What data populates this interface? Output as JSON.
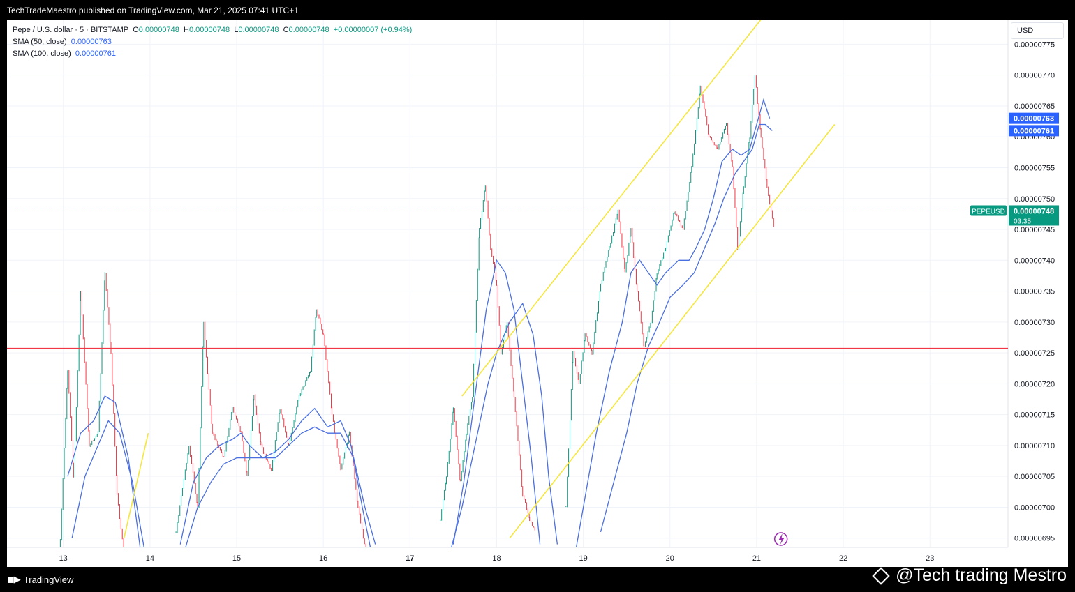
{
  "header": {
    "published_text": "TechTradeMaestro published on TradingView.com, Mar 21, 2025 07:41 UTC+1"
  },
  "legend": {
    "symbol": "Pepe / U.S. dollar · 5 · BITSTAMP",
    "o_label": "O",
    "o_value": "0.00000748",
    "h_label": "H",
    "h_value": "0.00000748",
    "l_label": "L",
    "l_value": "0.00000748",
    "c_label": "C",
    "c_value": "0.00000748",
    "change": "+0.00000007 (+0.94%)",
    "sma50_label": "SMA (50, close)",
    "sma50_value": "0.00000763",
    "sma100_label": "SMA (100, close)",
    "sma100_value": "0.00000761"
  },
  "currency": "USD",
  "footer": {
    "brand": "TradingView",
    "watermark": "@Tech trading Mestro"
  },
  "colors": {
    "up": "#089981",
    "down": "#f23645",
    "sma": "#4a6fe0",
    "support": "#f23645",
    "channel": "#f5e63c",
    "last": "#089981",
    "sma_label": "#2962ff"
  },
  "chart_data": {
    "type": "candlestick",
    "symbol": "PEPEUSD",
    "x_ticks": [
      {
        "label": "13",
        "x": 13.0
      },
      {
        "label": "14",
        "x": 14.0
      },
      {
        "label": "15",
        "x": 15.0
      },
      {
        "label": "16",
        "x": 16.0
      },
      {
        "label": "17",
        "x": 17.0
      },
      {
        "label": "18",
        "x": 18.0
      },
      {
        "label": "19",
        "x": 19.0
      },
      {
        "label": "20",
        "x": 20.0
      },
      {
        "label": "21",
        "x": 21.0
      },
      {
        "label": "22",
        "x": 22.0
      },
      {
        "label": "23",
        "x": 23.0
      }
    ],
    "xlim": [
      12.35,
      23.9
    ],
    "ylim": [
      6.935e-06,
      7.79e-06
    ],
    "y_ticks": [
      "0.00000695",
      "0.00000700",
      "0.00000705",
      "0.00000710",
      "0.00000715",
      "0.00000720",
      "0.00000725",
      "0.00000730",
      "0.00000735",
      "0.00000740",
      "0.00000745",
      "0.00000750",
      "0.00000755",
      "0.00000760",
      "0.00000765",
      "0.00000770",
      "0.00000775"
    ],
    "last_price": {
      "label": "PEPEUSD",
      "value": 7.48e-06,
      "value_text": "0.00000748",
      "countdown": "03:35"
    },
    "sma_labels": [
      {
        "text": "0.00000763",
        "value": 7.63e-06
      },
      {
        "text": "0.00000761",
        "value": 7.61e-06
      }
    ],
    "support_level": 7.257e-06,
    "channel_lines": [
      {
        "x": [
          17.6,
          21.05
        ],
        "y": [
          7.18e-06,
          7.79e-06
        ]
      },
      {
        "x": [
          18.15,
          21.9
        ],
        "y": [
          6.95e-06,
          7.62e-06
        ]
      },
      {
        "x": [
          13.7,
          13.98
        ],
        "y": [
          6.95e-06,
          7.12e-06
        ]
      }
    ],
    "price_path": [
      [
        12.95,
        6.9e-06
      ],
      [
        13.05,
        7.22e-06
      ],
      [
        13.12,
        7.05e-06
      ],
      [
        13.2,
        7.35e-06
      ],
      [
        13.3,
        7.1e-06
      ],
      [
        13.4,
        7.12e-06
      ],
      [
        13.48,
        7.38e-06
      ],
      [
        13.55,
        7.25e-06
      ],
      [
        13.62,
        7.02e-06
      ],
      [
        13.72,
        6.9e-06
      ],
      [
        14.3,
        6.96e-06
      ],
      [
        14.45,
        7.1e-06
      ],
      [
        14.55,
        7e-06
      ],
      [
        14.62,
        7.3e-06
      ],
      [
        14.72,
        7.12e-06
      ],
      [
        14.85,
        7.08e-06
      ],
      [
        14.95,
        7.16e-06
      ],
      [
        15.05,
        7.12e-06
      ],
      [
        15.12,
        7.05e-06
      ],
      [
        15.2,
        7.18e-06
      ],
      [
        15.28,
        7.1e-06
      ],
      [
        15.4,
        7.06e-06
      ],
      [
        15.5,
        7.16e-06
      ],
      [
        15.6,
        7.1e-06
      ],
      [
        15.72,
        7.18e-06
      ],
      [
        15.85,
        7.22e-06
      ],
      [
        15.92,
        7.32e-06
      ],
      [
        16.0,
        7.28e-06
      ],
      [
        16.1,
        7.15e-06
      ],
      [
        16.2,
        7.06e-06
      ],
      [
        16.3,
        7.12e-06
      ],
      [
        16.4,
        7e-06
      ],
      [
        16.5,
        6.92e-06
      ],
      [
        17.35,
        6.98e-06
      ],
      [
        17.42,
        7.05e-06
      ],
      [
        17.5,
        7.16e-06
      ],
      [
        17.58,
        7.04e-06
      ],
      [
        17.65,
        7.12e-06
      ],
      [
        17.72,
        7.18e-06
      ],
      [
        17.8,
        7.45e-06
      ],
      [
        17.87,
        7.52e-06
      ],
      [
        17.93,
        7.42e-06
      ],
      [
        18.0,
        7.36e-06
      ],
      [
        18.05,
        7.25e-06
      ],
      [
        18.12,
        7.3e-06
      ],
      [
        18.2,
        7.18e-06
      ],
      [
        18.3,
        7.02e-06
      ],
      [
        18.38,
        6.98e-06
      ],
      [
        18.45,
        6.96e-06
      ],
      [
        18.8,
        7e-06
      ],
      [
        18.88,
        7.25e-06
      ],
      [
        18.95,
        7.2e-06
      ],
      [
        19.02,
        7.28e-06
      ],
      [
        19.1,
        7.25e-06
      ],
      [
        19.2,
        7.36e-06
      ],
      [
        19.3,
        7.42e-06
      ],
      [
        19.4,
        7.48e-06
      ],
      [
        19.48,
        7.38e-06
      ],
      [
        19.55,
        7.45e-06
      ],
      [
        19.62,
        7.35e-06
      ],
      [
        19.7,
        7.26e-06
      ],
      [
        19.78,
        7.3e-06
      ],
      [
        19.85,
        7.38e-06
      ],
      [
        19.95,
        7.42e-06
      ],
      [
        20.05,
        7.48e-06
      ],
      [
        20.15,
        7.45e-06
      ],
      [
        20.25,
        7.55e-06
      ],
      [
        20.35,
        7.68e-06
      ],
      [
        20.45,
        7.6e-06
      ],
      [
        20.55,
        7.58e-06
      ],
      [
        20.65,
        7.62e-06
      ],
      [
        20.72,
        7.55e-06
      ],
      [
        20.78,
        7.42e-06
      ],
      [
        20.85,
        7.52e-06
      ],
      [
        20.92,
        7.6e-06
      ],
      [
        20.98,
        7.7e-06
      ],
      [
        21.05,
        7.6e-06
      ],
      [
        21.12,
        7.52e-06
      ],
      [
        21.2,
        7.45e-06
      ]
    ],
    "sma_50": [
      [
        13.05,
        7.05e-06
      ],
      [
        13.2,
        7.12e-06
      ],
      [
        13.35,
        7.14e-06
      ],
      [
        13.48,
        7.18e-06
      ],
      [
        13.6,
        7.17e-06
      ],
      [
        13.75,
        7.08e-06
      ],
      [
        13.9,
        6.92e-06
      ],
      [
        14.35,
        6.94e-06
      ],
      [
        14.5,
        7.04e-06
      ],
      [
        14.65,
        7.08e-06
      ],
      [
        14.8,
        7.1e-06
      ],
      [
        14.95,
        7.11e-06
      ],
      [
        15.05,
        7.12e-06
      ],
      [
        15.15,
        7.1e-06
      ],
      [
        15.3,
        7.08e-06
      ],
      [
        15.45,
        7.09e-06
      ],
      [
        15.6,
        7.11e-06
      ],
      [
        15.75,
        7.14e-06
      ],
      [
        15.9,
        7.16e-06
      ],
      [
        16.05,
        7.13e-06
      ],
      [
        16.2,
        7.14e-06
      ],
      [
        16.32,
        7.1e-06
      ],
      [
        16.45,
        7e-06
      ],
      [
        16.55,
        6.93e-06
      ],
      [
        17.5,
        6.94e-06
      ],
      [
        17.62,
        7.04e-06
      ],
      [
        17.75,
        7.18e-06
      ],
      [
        17.88,
        7.32e-06
      ],
      [
        18.0,
        7.4e-06
      ],
      [
        18.1,
        7.38e-06
      ],
      [
        18.2,
        7.32e-06
      ],
      [
        18.3,
        7.2e-06
      ],
      [
        18.4,
        7.08e-06
      ],
      [
        18.5,
        6.94e-06
      ],
      [
        18.9,
        6.92e-06
      ],
      [
        19.0,
        7e-06
      ],
      [
        19.15,
        7.12e-06
      ],
      [
        19.3,
        7.22e-06
      ],
      [
        19.45,
        7.3e-06
      ],
      [
        19.55,
        7.38e-06
      ],
      [
        19.65,
        7.4e-06
      ],
      [
        19.75,
        7.38e-06
      ],
      [
        19.85,
        7.36e-06
      ],
      [
        19.95,
        7.38e-06
      ],
      [
        20.1,
        7.4e-06
      ],
      [
        20.22,
        7.4e-06
      ],
      [
        20.3,
        7.42e-06
      ],
      [
        20.4,
        7.45e-06
      ],
      [
        20.5,
        7.5e-06
      ],
      [
        20.6,
        7.56e-06
      ],
      [
        20.72,
        7.58e-06
      ],
      [
        20.82,
        7.57e-06
      ],
      [
        20.92,
        7.58e-06
      ],
      [
        21.0,
        7.62e-06
      ],
      [
        21.08,
        7.66e-06
      ],
      [
        21.15,
        7.63e-06
      ]
    ],
    "sma_100": [
      [
        13.1,
        6.95e-06
      ],
      [
        13.25,
        7.05e-06
      ],
      [
        13.4,
        7.1e-06
      ],
      [
        13.52,
        7.14e-06
      ],
      [
        13.65,
        7.12e-06
      ],
      [
        13.8,
        7.04e-06
      ],
      [
        13.95,
        6.92e-06
      ],
      [
        14.4,
        6.93e-06
      ],
      [
        14.55,
        7e-06
      ],
      [
        14.7,
        7.04e-06
      ],
      [
        14.85,
        7.07e-06
      ],
      [
        15.0,
        7.08e-06
      ],
      [
        15.15,
        7.08e-06
      ],
      [
        15.3,
        7.08e-06
      ],
      [
        15.45,
        7.08e-06
      ],
      [
        15.6,
        7.1e-06
      ],
      [
        15.75,
        7.12e-06
      ],
      [
        15.9,
        7.13e-06
      ],
      [
        16.05,
        7.12e-06
      ],
      [
        16.2,
        7.12e-06
      ],
      [
        16.35,
        7.08e-06
      ],
      [
        16.48,
        7e-06
      ],
      [
        16.6,
        6.94e-06
      ],
      [
        17.45,
        6.92e-06
      ],
      [
        17.6,
        7e-06
      ],
      [
        17.75,
        7.1e-06
      ],
      [
        17.9,
        7.2e-06
      ],
      [
        18.0,
        7.25e-06
      ],
      [
        18.15,
        7.3e-06
      ],
      [
        18.3,
        7.33e-06
      ],
      [
        18.42,
        7.28e-06
      ],
      [
        18.52,
        7.18e-06
      ],
      [
        18.6,
        7.05e-06
      ],
      [
        18.7,
        6.94e-06
      ],
      [
        19.2,
        6.96e-06
      ],
      [
        19.35,
        7.04e-06
      ],
      [
        19.5,
        7.12e-06
      ],
      [
        19.62,
        7.2e-06
      ],
      [
        19.75,
        7.26e-06
      ],
      [
        19.88,
        7.3e-06
      ],
      [
        20.0,
        7.34e-06
      ],
      [
        20.15,
        7.36e-06
      ],
      [
        20.28,
        7.38e-06
      ],
      [
        20.4,
        7.42e-06
      ],
      [
        20.52,
        7.46e-06
      ],
      [
        20.62,
        7.5e-06
      ],
      [
        20.75,
        7.54e-06
      ],
      [
        20.85,
        7.56e-06
      ],
      [
        20.95,
        7.58e-06
      ],
      [
        21.03,
        7.62e-06
      ],
      [
        21.1,
        7.62e-06
      ],
      [
        21.18,
        7.61e-06
      ]
    ]
  }
}
